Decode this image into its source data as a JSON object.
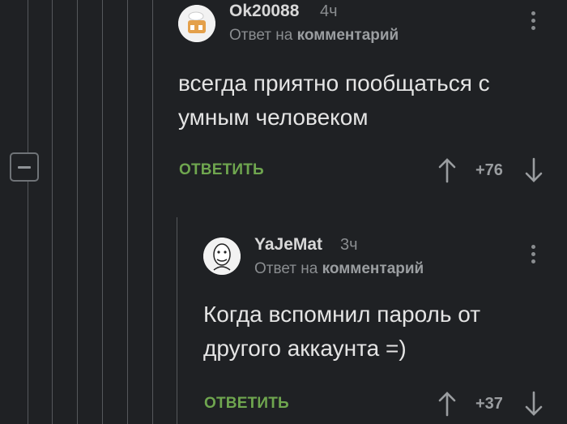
{
  "comment1": {
    "username": "Ok20088",
    "time": "4ч",
    "reply_prefix": "Ответ на",
    "reply_target": "комментарий",
    "text": "всегда приятно пообщаться с умным человеком",
    "reply_label": "ОТВЕТИТЬ",
    "score": "+76"
  },
  "comment2": {
    "username": "YaJeMat",
    "time": "3ч",
    "reply_prefix": "Ответ на",
    "reply_target": "комментарий",
    "text": "Когда вспомнил пароль от другого аккаунта =)",
    "reply_label": "ОТВЕТИТЬ",
    "score": "+37"
  },
  "icons": {
    "collapse": "minus-square-icon",
    "upvote": "arrow-up-icon",
    "downvote": "arrow-down-icon",
    "menu": "vertical-dots-icon"
  },
  "colors": {
    "background": "#1f2124",
    "reply_green": "#6fa64f",
    "muted": "#8a8d90"
  }
}
